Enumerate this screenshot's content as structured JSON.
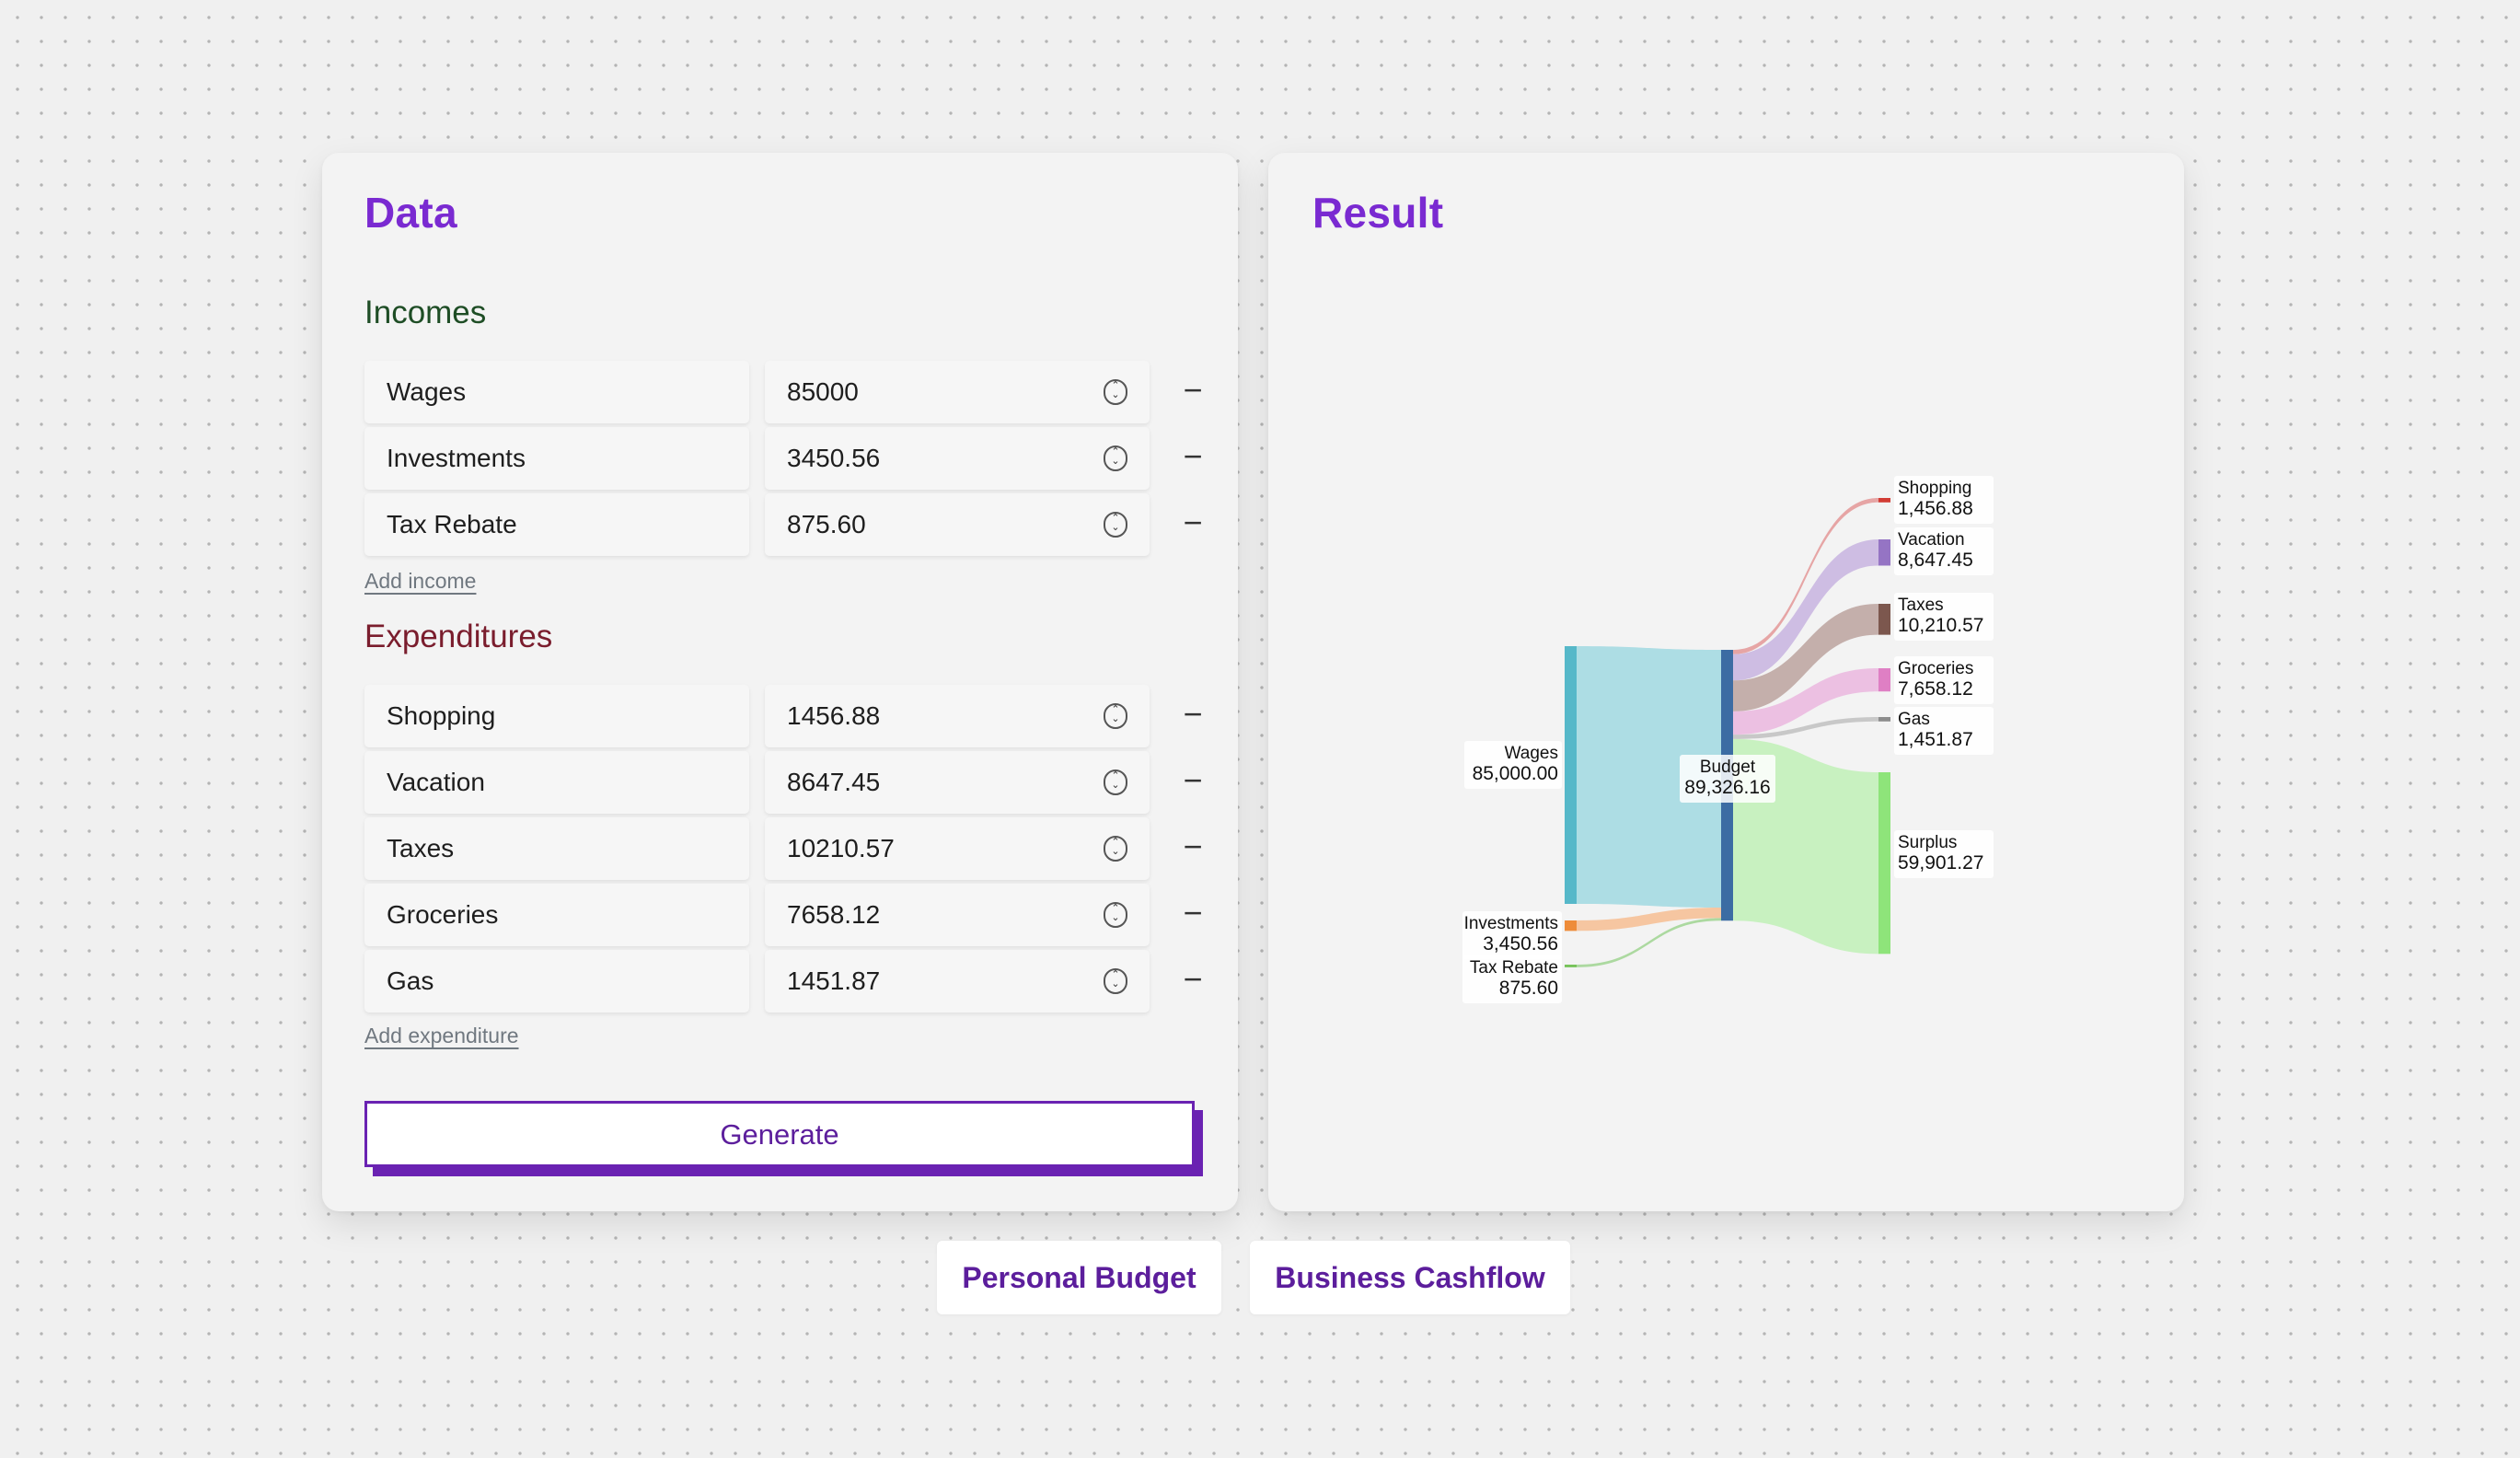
{
  "data_panel": {
    "title": "Data",
    "incomes_title": "Incomes",
    "incomes": [
      {
        "name": "Wages",
        "value": "85000"
      },
      {
        "name": "Investments",
        "value": "3450.56"
      },
      {
        "name": "Tax Rebate",
        "value": "875.60"
      }
    ],
    "add_income_label": "Add income",
    "expenditures_title": "Expenditures",
    "expenditures": [
      {
        "name": "Shopping",
        "value": "1456.88"
      },
      {
        "name": "Vacation",
        "value": "8647.45"
      },
      {
        "name": "Taxes",
        "value": "10210.57"
      },
      {
        "name": "Groceries",
        "value": "7658.12"
      },
      {
        "name": "Gas",
        "value": "1451.87"
      }
    ],
    "add_expenditure_label": "Add expenditure",
    "generate_label": "Generate",
    "remove_symbol": "−"
  },
  "result_panel": {
    "title": "Result"
  },
  "presets": {
    "personal_label": "Personal Budget",
    "business_label": "Business Cashflow"
  },
  "colors": {
    "accent": "#7a2ad1",
    "incomes_heading": "#1e4d25",
    "expenditures_heading": "#7a1d2d",
    "button": "#6a22b2"
  },
  "chart_data": {
    "type": "sankey",
    "center_node": {
      "name": "Budget",
      "value_label": "89,326.16",
      "value": 89326.16,
      "color": "#3c6ca3"
    },
    "sources": [
      {
        "name": "Wages",
        "value": 85000.0,
        "value_label": "85,000.00",
        "color": "#56b8c9",
        "link_color": "#a9dbe3"
      },
      {
        "name": "Investments",
        "value": 3450.56,
        "value_label": "3,450.56",
        "color": "#ee8c3a",
        "link_color": "#f5c39c"
      },
      {
        "name": "Tax Rebate",
        "value": 875.6,
        "value_label": "875.60",
        "color": "#76c35a",
        "link_color": "#a8d79b"
      }
    ],
    "targets": [
      {
        "name": "Shopping",
        "value": 1456.88,
        "value_label": "1,456.88",
        "color": "#d23c34",
        "link_color": "#e5a0a0"
      },
      {
        "name": "Vacation",
        "value": 8647.45,
        "value_label": "8,647.45",
        "color": "#9574c4",
        "link_color": "#cbb9e2"
      },
      {
        "name": "Taxes",
        "value": 10210.57,
        "value_label": "10,210.57",
        "color": "#7c574e",
        "link_color": "#c1aba7"
      },
      {
        "name": "Groceries",
        "value": 7658.12,
        "value_label": "7,658.12",
        "color": "#df7fc4",
        "link_color": "#ebbde0"
      },
      {
        "name": "Gas",
        "value": 1451.87,
        "value_label": "1,451.87",
        "color": "#8c8c8c",
        "link_color": "#c5c5c5"
      },
      {
        "name": "Surplus",
        "value": 59901.27,
        "value_label": "59,901.27",
        "color": "#8ee47a",
        "link_color": "#c5f0bd"
      }
    ]
  }
}
